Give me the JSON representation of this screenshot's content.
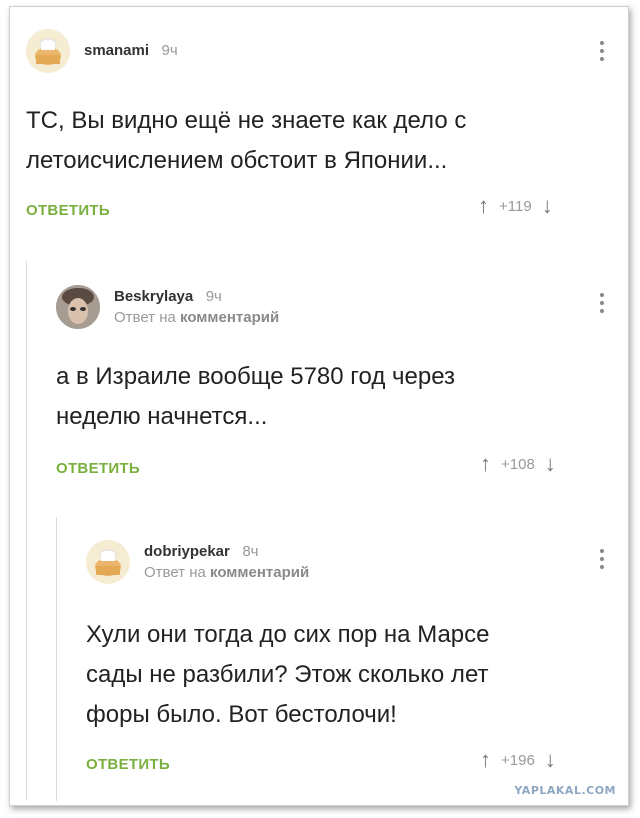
{
  "comments": [
    {
      "username": "smanami",
      "time": "9ч",
      "text_lines": [
        "ТС, Вы видно ещё не знаете как дело с",
        "летоисчислением обстоит в Японии..."
      ],
      "reply_label": "ОТВЕТИТЬ",
      "score": "+119"
    },
    {
      "username": "Beskrylaya",
      "time": "9ч",
      "reply_prefix": "Ответ на",
      "reply_target": "комментарий",
      "text_lines": [
        "а в Израиле вообще 5780 год через",
        "неделю начнется..."
      ],
      "reply_label": "ОТВЕТИТЬ",
      "score": "+108"
    },
    {
      "username": "dobriypekar",
      "time": "8ч",
      "reply_prefix": "Ответ на",
      "reply_target": "комментарий",
      "text_lines": [
        "Хули они тогда до сих пор на Марсе",
        "сады не разбили? Этож сколько лет",
        "форы было. Вот бестолочи!"
      ],
      "reply_label": "ОТВЕТИТЬ",
      "score": "+196"
    }
  ],
  "icons": {
    "upvote": "arrow-up-icon",
    "downvote": "arrow-down-icon",
    "menu": "kebab-menu-icon"
  },
  "colors": {
    "reply_green": "#7ab03f",
    "text": "#222222",
    "muted": "#999999"
  },
  "watermark": "YAPLAKAL.COM"
}
